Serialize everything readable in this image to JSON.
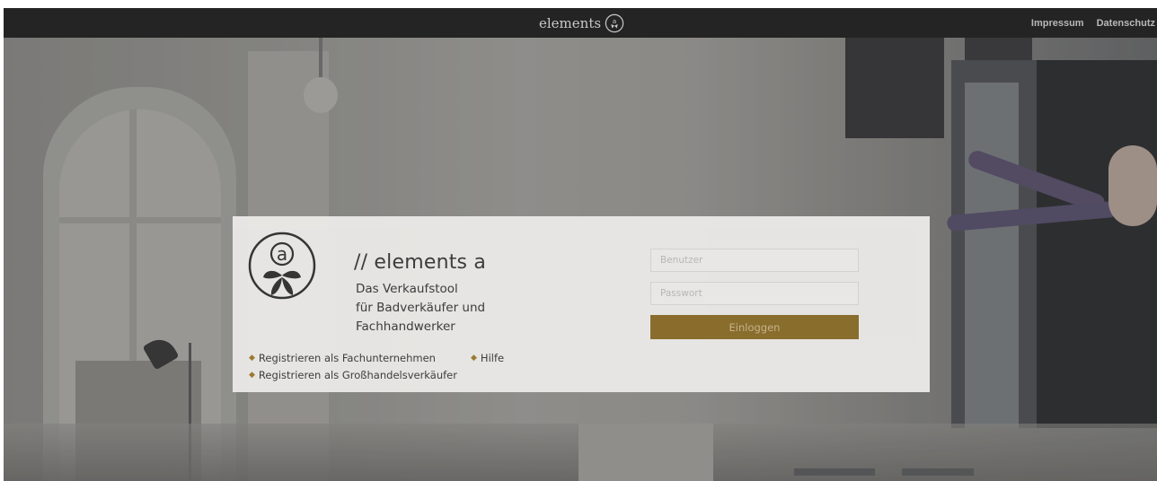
{
  "topbar": {
    "brand_name": "elements",
    "brand_icon": "elements-emblem-icon",
    "links": [
      "Impressum",
      "Datenschutz"
    ]
  },
  "login": {
    "logo_icon": "elements-a-emblem-icon",
    "title": "// elements a",
    "tagline": [
      "Das Verkaufstool",
      "für Badverkäufer und",
      "Fachhandwerker"
    ],
    "links": {
      "register_company": "Registrieren als Fachunternehmen",
      "register_wholesale": "Registrieren als Großhandelsverkäufer",
      "help": "Hilfe"
    },
    "username_placeholder": "Benutzer",
    "password_placeholder": "Passwort",
    "submit_label": "Einloggen"
  },
  "colors": {
    "topbar": "#242424",
    "accent": "#8a6d2b",
    "panel": "#e9e8e6"
  }
}
